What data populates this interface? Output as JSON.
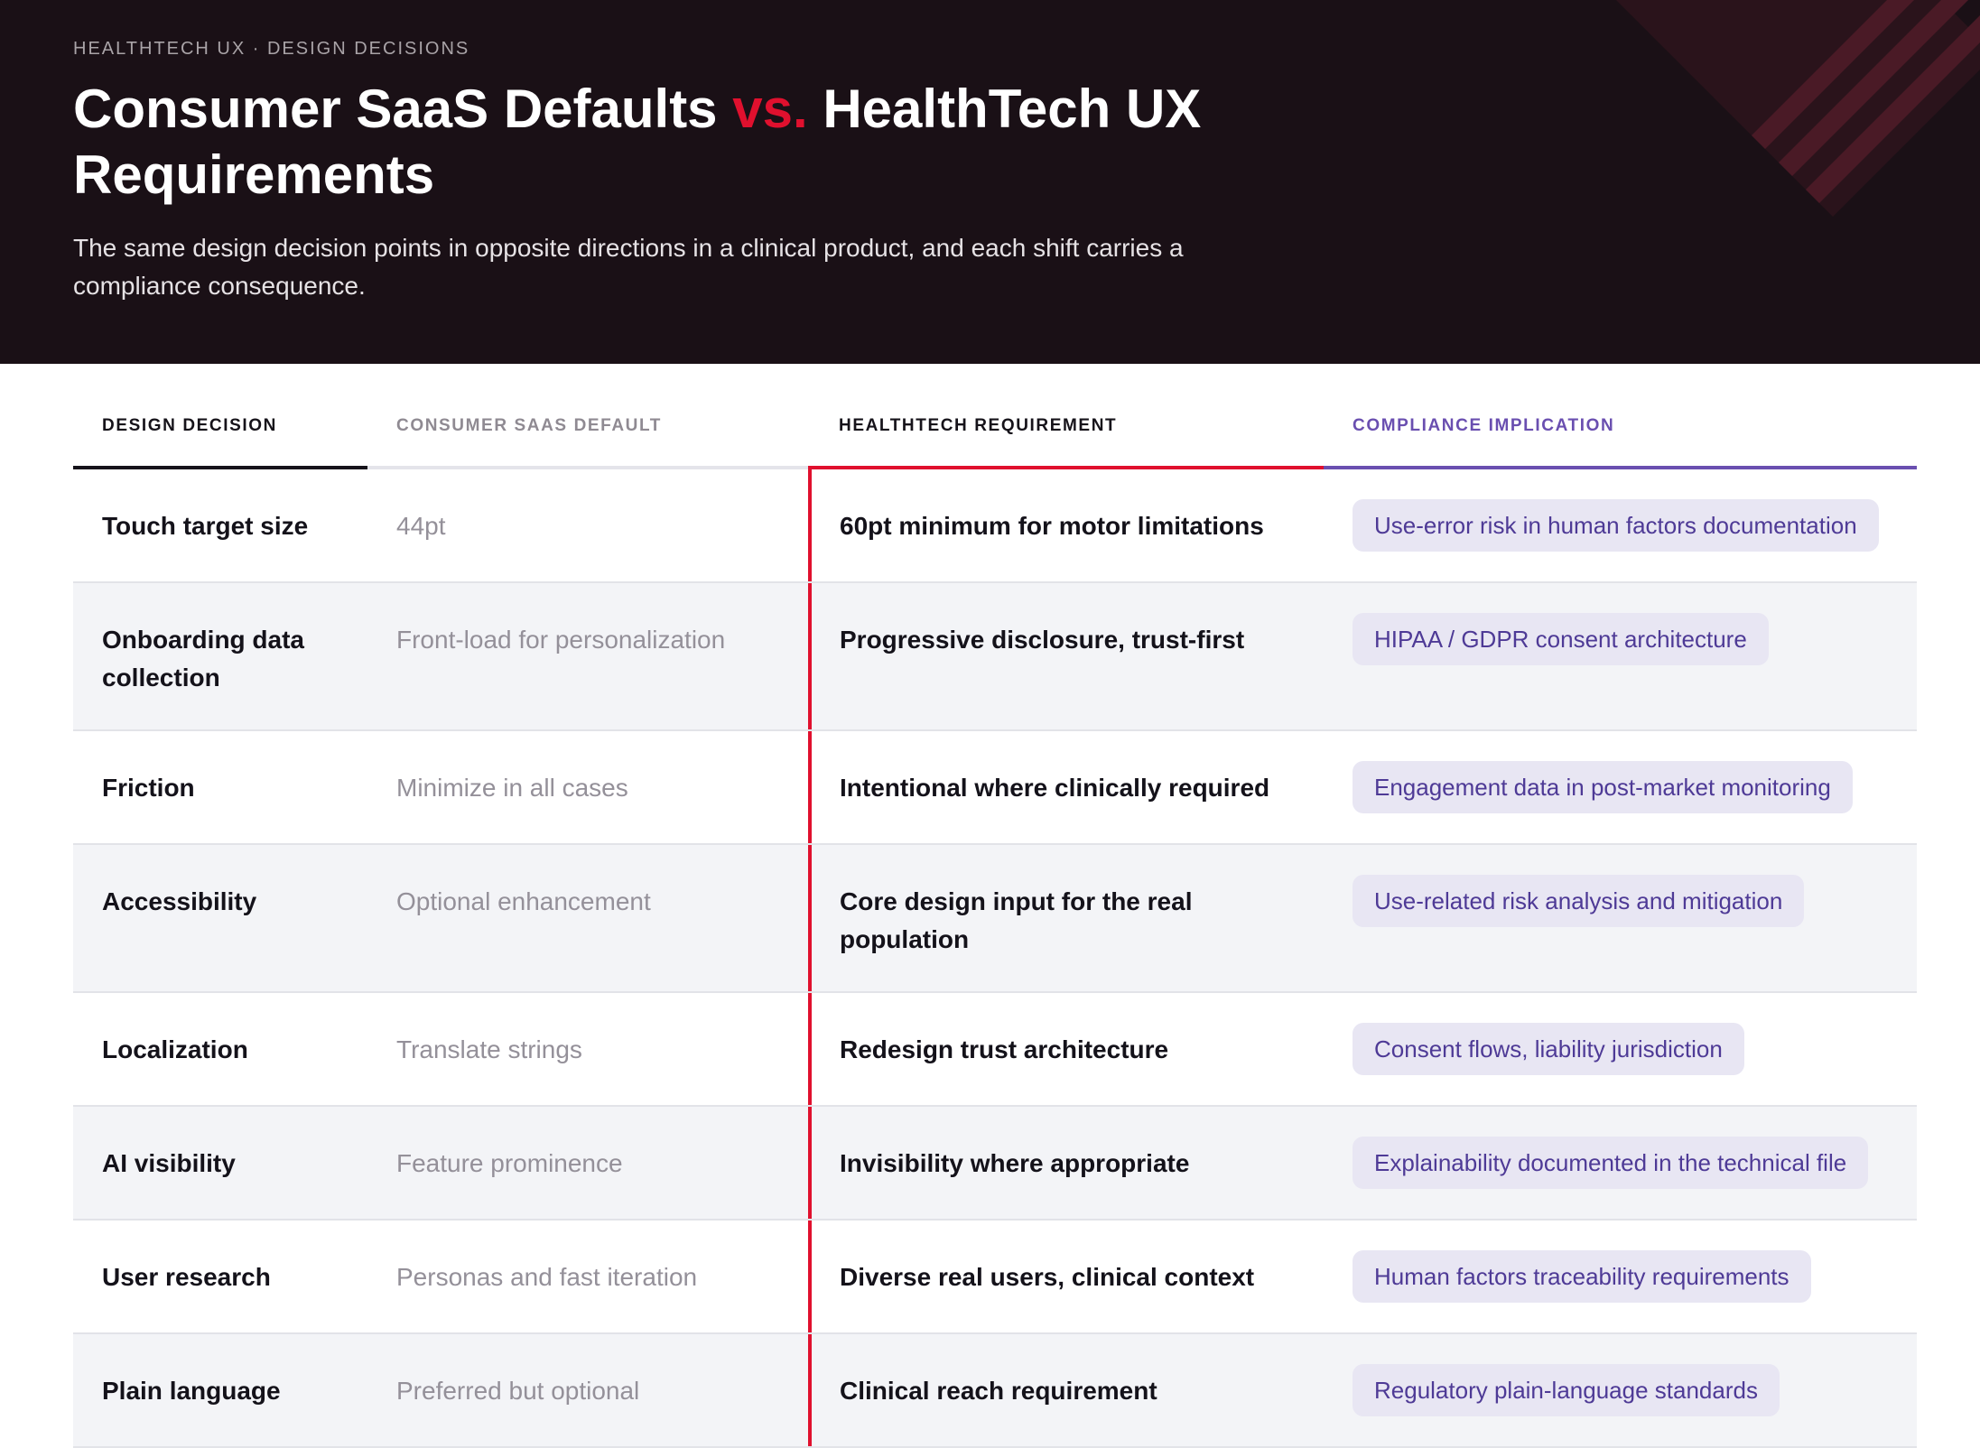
{
  "header": {
    "eyebrow": "HEALTHTECH UX · DESIGN DECISIONS",
    "title_part1": "Consumer SaaS Defaults ",
    "title_vs": "vs.",
    "title_part2": " HealthTech UX Requirements",
    "subtitle": "The same design decision points in opposite directions in a clinical product, and each shift carries a compliance consequence.",
    "accent_color": "#e0102e",
    "background_color": "#1a1016"
  },
  "table": {
    "columns": [
      "DESIGN DECISION",
      "CONSUMER SAAS DEFAULT",
      "HEALTHTECH REQUIREMENT",
      "COMPLIANCE IMPLICATION"
    ],
    "column_colors": [
      "#16131a",
      "#8f8a92",
      "#e0102e",
      "#6a4fb0"
    ],
    "rows": [
      {
        "decision": "Touch target size",
        "consumer": "44pt",
        "healthtech": "60pt minimum for motor limitations",
        "compliance": "Use-error risk in human factors documentation"
      },
      {
        "decision": "Onboarding data collection",
        "consumer": "Front-load for personalization",
        "healthtech": "Progressive disclosure, trust-first",
        "compliance": "HIPAA / GDPR consent architecture"
      },
      {
        "decision": "Friction",
        "consumer": "Minimize in all cases",
        "healthtech": "Intentional where clinically required",
        "compliance": "Engagement data in post-market monitoring"
      },
      {
        "decision": "Accessibility",
        "consumer": "Optional enhancement",
        "healthtech": "Core design input for the real population",
        "compliance": "Use-related risk analysis and mitigation"
      },
      {
        "decision": "Localization",
        "consumer": "Translate strings",
        "healthtech": "Redesign trust architecture",
        "compliance": "Consent flows, liability jurisdiction"
      },
      {
        "decision": "AI visibility",
        "consumer": "Feature prominence",
        "healthtech": "Invisibility where appropriate",
        "compliance": "Explainability documented in the technical file"
      },
      {
        "decision": "User research",
        "consumer": "Personas and fast iteration",
        "healthtech": "Diverse real users, clinical context",
        "compliance": "Human factors traceability requirements"
      },
      {
        "decision": "Plain language",
        "consumer": "Preferred but optional",
        "healthtech": "Clinical reach requirement",
        "compliance": "Regulatory plain-language standards"
      }
    ]
  }
}
